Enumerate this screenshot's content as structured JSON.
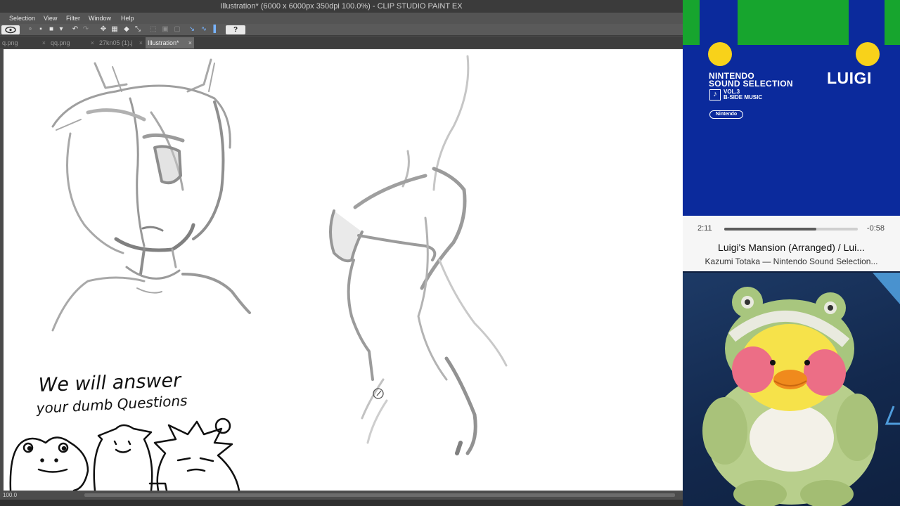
{
  "app": {
    "window_title": "Illustration* (6000 x 6000px 350dpi 100.0%)  - CLIP STUDIO PAINT EX",
    "menu": [
      "Selection",
      "View",
      "Filter",
      "Window",
      "Help"
    ],
    "tabs": [
      {
        "label": "q.png",
        "active": false
      },
      {
        "label": "qq.png",
        "active": false
      },
      {
        "label": "27kn05 (1).j",
        "active": false
      },
      {
        "label": "Illustration*",
        "active": true
      }
    ],
    "tab_close": "×",
    "help_label": "?",
    "status_zoom": "100.0"
  },
  "canvas": {
    "caption_line1": "We will answer",
    "caption_line2": "your dumb Questions"
  },
  "music": {
    "album": {
      "series_line1": "NINTENDO",
      "series_line2": "SOUND SELECTION",
      "volume_line1": "VOL.3",
      "volume_line2": "B-SIDE MUSIC",
      "publisher": "Nintendo",
      "character": "LUIGI"
    },
    "elapsed": "2:11",
    "remaining": "-0:58",
    "progress": 0.69,
    "track_title": "Luigi's Mansion (Arranged) / Lui...",
    "track_artist": "Kazumi Totaka — Nintendo Sound Selection..."
  },
  "colors": {
    "album_blue": "#0b2a9c",
    "album_green": "#17a52e",
    "album_yellow": "#f8d21a"
  }
}
